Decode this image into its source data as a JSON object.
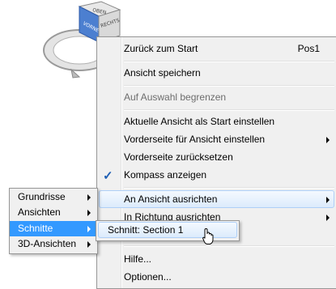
{
  "viewcube": {
    "top_label": "OBEN",
    "front_label": "VORNE",
    "right_label": "RECHTS"
  },
  "main_menu": {
    "items": [
      {
        "label": "Zurück zum Start",
        "shortcut": "Pos1"
      },
      {
        "label": "Ansicht speichern"
      },
      {
        "label": "Auf Auswahl begrenzen",
        "disabled": true
      },
      {
        "label": "Aktuelle Ansicht als Start einstellen"
      },
      {
        "label": "Vorderseite für Ansicht einstellen",
        "submenu": true
      },
      {
        "label": "Vorderseite zurücksetzen"
      },
      {
        "label": "Kompass anzeigen",
        "checked": true
      },
      {
        "label": "An Ansicht ausrichten",
        "submenu": true,
        "highlighted": true
      },
      {
        "label": "In Richtung ausrichten",
        "submenu": true
      },
      {
        "label": "Hilfe..."
      },
      {
        "label": "Optionen..."
      }
    ]
  },
  "left_menu": {
    "items": [
      {
        "label": "Grundrisse"
      },
      {
        "label": "Ansichten"
      },
      {
        "label": "Schnitte",
        "selected": true
      },
      {
        "label": "3D-Ansichten"
      }
    ]
  },
  "sub_menu": {
    "items": [
      {
        "label": "Schnitt: Section 1"
      }
    ]
  },
  "colors": {
    "highlight_border": "#aecff7",
    "selected_bg": "#3399ff",
    "menu_bg": "#f0f0f0"
  }
}
